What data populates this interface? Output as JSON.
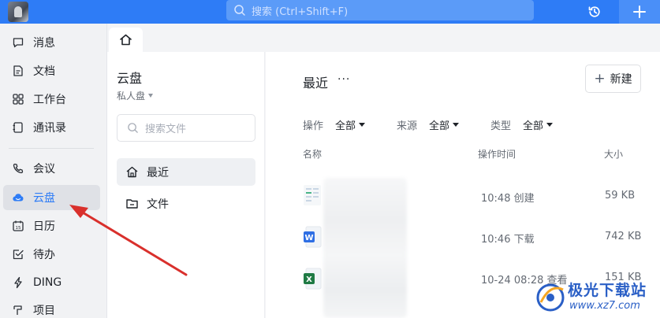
{
  "topbar": {
    "search_placeholder": "搜索 (Ctrl+Shift+F)",
    "icons": [
      "app-avatar",
      "search-icon",
      "history-icon",
      "plus-icon"
    ],
    "accent": "#2e7cf6"
  },
  "sidebar": {
    "items": [
      {
        "label": "消息",
        "icon": "message-icon"
      },
      {
        "label": "文档",
        "icon": "document-icon"
      },
      {
        "label": "工作台",
        "icon": "workbench-icon"
      },
      {
        "label": "通讯录",
        "icon": "contacts-icon"
      },
      {
        "label": "会议",
        "icon": "meeting-icon"
      },
      {
        "label": "云盘",
        "icon": "cloud-icon",
        "active": true
      },
      {
        "label": "日历",
        "icon": "calendar-icon"
      },
      {
        "label": "待办",
        "icon": "todo-icon"
      },
      {
        "label": "DING",
        "icon": "ding-icon"
      },
      {
        "label": "项目",
        "icon": "project-icon"
      }
    ]
  },
  "tabs": {
    "home_icon": "home-icon"
  },
  "middle": {
    "title": "云盘",
    "subtitle": "私人盘",
    "search_placeholder": "搜索文件",
    "items": [
      {
        "label": "最近",
        "icon": "home-outline-icon",
        "active": true
      },
      {
        "label": "文件",
        "icon": "folder-icon"
      }
    ]
  },
  "main": {
    "title": "最近",
    "more": "···",
    "new_button": "新建",
    "filters": [
      {
        "label": "操作",
        "value": "全部"
      },
      {
        "label": "来源",
        "value": "全部"
      },
      {
        "label": "类型",
        "value": "全部"
      }
    ],
    "columns": {
      "name": "名称",
      "time": "操作时间",
      "size": "大小"
    },
    "rows": [
      {
        "time": "10:48 创建",
        "size": "59 KB",
        "icon": "sheet-file-icon"
      },
      {
        "time": "10:46 下载",
        "size": "742 KB",
        "icon": "word-file-icon"
      },
      {
        "time": "10-24 08:28 查看",
        "size": "151 KB",
        "icon": "excel-file-icon"
      }
    ]
  },
  "watermark": {
    "line1": "极光下载站",
    "line2": "www.xz7.com"
  }
}
